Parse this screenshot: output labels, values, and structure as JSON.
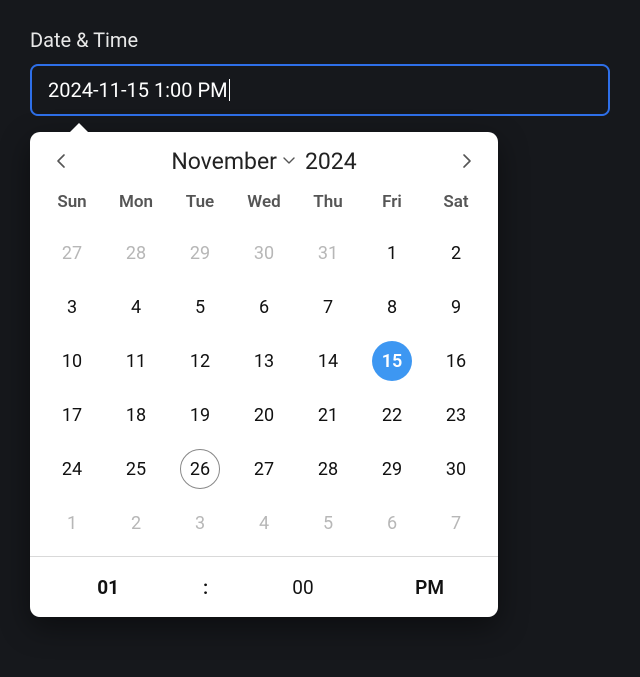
{
  "field": {
    "label": "Date & Time",
    "value": "2024-11-15 1:00 PM"
  },
  "calendar": {
    "month": "November",
    "year": "2024",
    "dow": [
      "Sun",
      "Mon",
      "Tue",
      "Wed",
      "Thu",
      "Fri",
      "Sat"
    ],
    "weeks": [
      [
        {
          "d": "27",
          "outside": true
        },
        {
          "d": "28",
          "outside": true
        },
        {
          "d": "29",
          "outside": true
        },
        {
          "d": "30",
          "outside": true
        },
        {
          "d": "31",
          "outside": true
        },
        {
          "d": "1"
        },
        {
          "d": "2"
        }
      ],
      [
        {
          "d": "3"
        },
        {
          "d": "4"
        },
        {
          "d": "5"
        },
        {
          "d": "6"
        },
        {
          "d": "7"
        },
        {
          "d": "8"
        },
        {
          "d": "9"
        }
      ],
      [
        {
          "d": "10"
        },
        {
          "d": "11"
        },
        {
          "d": "12"
        },
        {
          "d": "13"
        },
        {
          "d": "14"
        },
        {
          "d": "15",
          "selected": true
        },
        {
          "d": "16"
        }
      ],
      [
        {
          "d": "17"
        },
        {
          "d": "18"
        },
        {
          "d": "19"
        },
        {
          "d": "20"
        },
        {
          "d": "21"
        },
        {
          "d": "22"
        },
        {
          "d": "23"
        }
      ],
      [
        {
          "d": "24"
        },
        {
          "d": "25"
        },
        {
          "d": "26",
          "today": true
        },
        {
          "d": "27"
        },
        {
          "d": "28"
        },
        {
          "d": "29"
        },
        {
          "d": "30"
        }
      ],
      [
        {
          "d": "1",
          "outside": true
        },
        {
          "d": "2",
          "outside": true
        },
        {
          "d": "3",
          "outside": true
        },
        {
          "d": "4",
          "outside": true
        },
        {
          "d": "5",
          "outside": true
        },
        {
          "d": "6",
          "outside": true
        },
        {
          "d": "7",
          "outside": true
        }
      ]
    ]
  },
  "time": {
    "hour": "01",
    "colon": ":",
    "minute": "00",
    "ampm": "PM"
  }
}
